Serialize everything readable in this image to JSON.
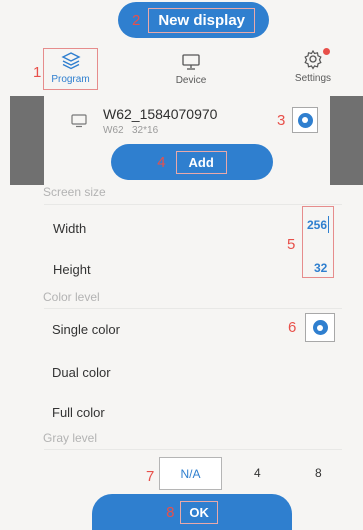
{
  "top_bar": {
    "marker": "2",
    "new_display_label": "New display"
  },
  "tabs": {
    "marker": "1",
    "items": [
      {
        "label": "Program",
        "icon": "layers-icon",
        "active": true
      },
      {
        "label": "Device",
        "icon": "monitor-icon",
        "active": false
      },
      {
        "label": "Settings",
        "icon": "gear-icon",
        "active": false,
        "notification": true
      }
    ]
  },
  "device": {
    "name": "W62_1584070970",
    "model": "W62",
    "resolution": "32*16",
    "marker": "3",
    "selected": true
  },
  "add": {
    "marker": "4",
    "label": "Add"
  },
  "screen_size": {
    "title": "Screen size",
    "width_label": "Width",
    "width_value": "256",
    "height_label": "Height",
    "height_value": "32",
    "marker": "5"
  },
  "color_level": {
    "title": "Color level",
    "options": [
      "Single color",
      "Dual color",
      "Full color"
    ],
    "selected": "Single color",
    "marker": "6"
  },
  "gray_level": {
    "title": "Gray level",
    "marker": "7",
    "options": [
      "N/A",
      "4",
      "8"
    ],
    "selected": "N/A"
  },
  "ok": {
    "marker": "8",
    "label": "OK"
  },
  "colors": {
    "accent": "#2f7fcf",
    "marker": "#e8504a",
    "notification": "#e8504a"
  }
}
